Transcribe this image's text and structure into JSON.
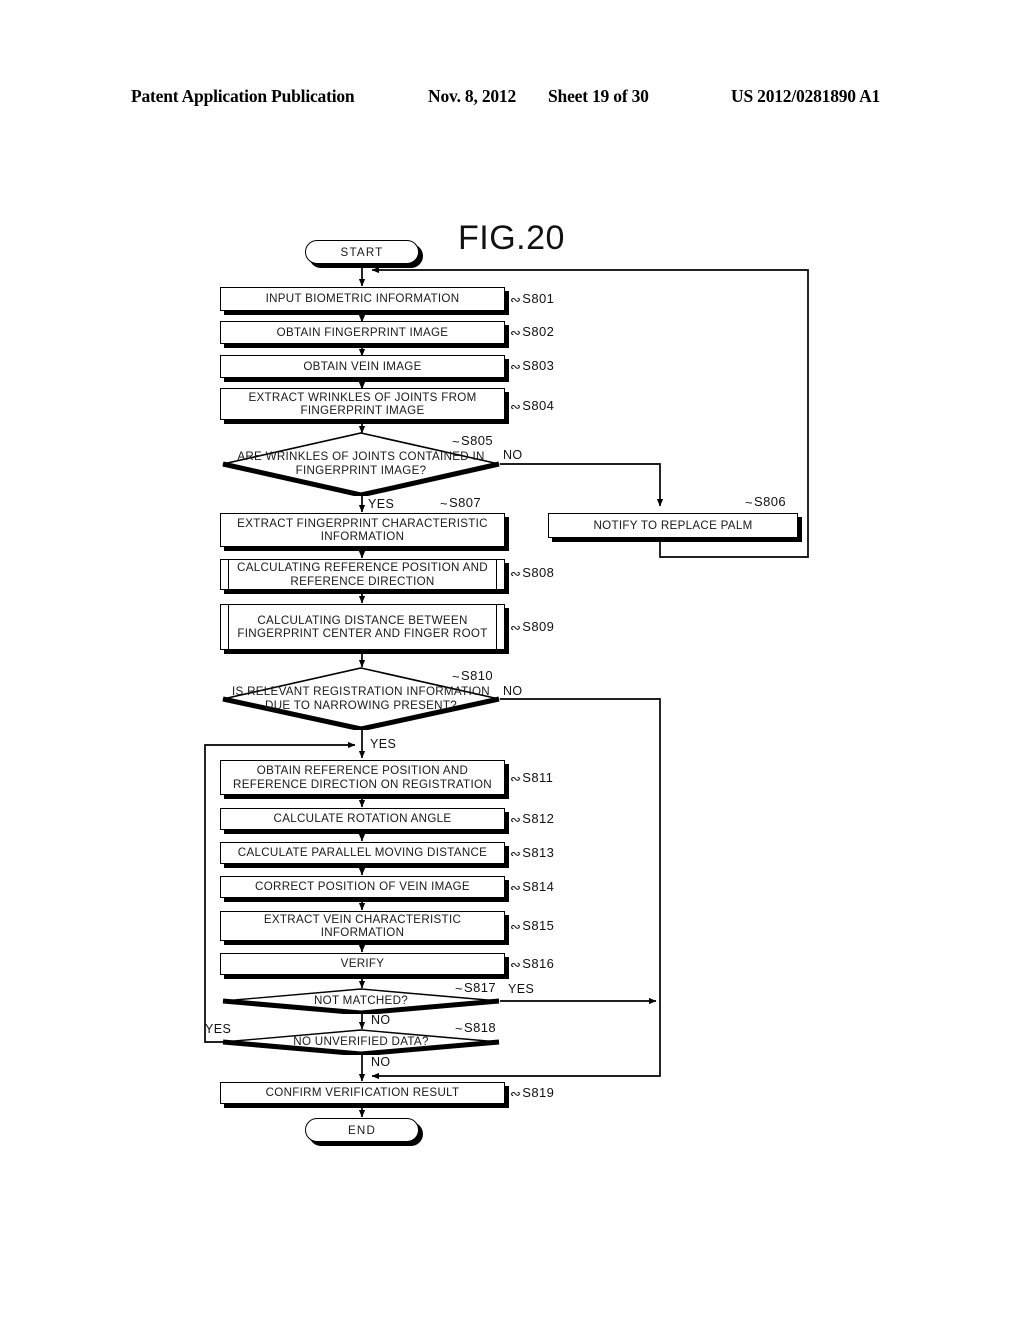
{
  "header": {
    "publication": "Patent Application Publication",
    "date": "Nov. 8, 2012",
    "sheet": "Sheet 19 of 30",
    "patent_number": "US 2012/0281890 A1"
  },
  "figure": {
    "title": "FIG.20"
  },
  "flowchart": {
    "terminators": {
      "start": "START",
      "end": "END"
    },
    "nodes": [
      {
        "id": "S801",
        "type": "process",
        "label": "INPUT BIOMETRIC INFORMATION",
        "ref": "S801"
      },
      {
        "id": "S802",
        "type": "process",
        "label": "OBTAIN FINGERPRINT IMAGE",
        "ref": "S802"
      },
      {
        "id": "S803",
        "type": "process",
        "label": "OBTAIN VEIN IMAGE",
        "ref": "S803"
      },
      {
        "id": "S804",
        "type": "process",
        "label": "EXTRACT WRINKLES OF JOINTS FROM FINGERPRINT IMAGE",
        "ref": "S804"
      },
      {
        "id": "S805",
        "type": "decision",
        "label": "ARE WRINKLES OF JOINTS CONTAINED IN FINGERPRINT IMAGE?",
        "ref": "S805"
      },
      {
        "id": "S806",
        "type": "process",
        "label": "NOTIFY TO REPLACE PALM",
        "ref": "S806"
      },
      {
        "id": "S807",
        "type": "process",
        "label": "EXTRACT FINGERPRINT CHARACTERISTIC INFORMATION",
        "ref": "S807"
      },
      {
        "id": "S808",
        "type": "predefined",
        "label": "CALCULATING REFERENCE POSITION AND REFERENCE DIRECTION",
        "ref": "S808"
      },
      {
        "id": "S809",
        "type": "predefined",
        "label": "CALCULATING DISTANCE BETWEEN FINGERPRINT CENTER AND FINGER ROOT",
        "ref": "S809"
      },
      {
        "id": "S810",
        "type": "decision",
        "label": "IS RELEVANT REGISTRATION INFORMATION DUE TO NARROWING PRESENT?",
        "ref": "S810"
      },
      {
        "id": "S811",
        "type": "process",
        "label": "OBTAIN REFERENCE POSITION AND REFERENCE DIRECTION ON REGISTRATION",
        "ref": "S811"
      },
      {
        "id": "S812",
        "type": "process",
        "label": "CALCULATE ROTATION ANGLE",
        "ref": "S812"
      },
      {
        "id": "S813",
        "type": "process",
        "label": "CALCULATE PARALLEL MOVING DISTANCE",
        "ref": "S813"
      },
      {
        "id": "S814",
        "type": "process",
        "label": "CORRECT POSITION OF VEIN IMAGE",
        "ref": "S814"
      },
      {
        "id": "S815",
        "type": "process",
        "label": "EXTRACT VEIN CHARACTERISTIC INFORMATION",
        "ref": "S815"
      },
      {
        "id": "S816",
        "type": "process",
        "label": "VERIFY",
        "ref": "S816"
      },
      {
        "id": "S817",
        "type": "decision-flat",
        "label": "NOT MATCHED?",
        "ref": "S817"
      },
      {
        "id": "S818",
        "type": "decision-flat",
        "label": "NO UNVERIFIED DATA?",
        "ref": "S818"
      },
      {
        "id": "S819",
        "type": "process",
        "label": "CONFIRM VERIFICATION RESULT",
        "ref": "S819"
      }
    ],
    "branch_labels": {
      "s805_no": "NO",
      "s805_yes": "YES",
      "s810_no": "NO",
      "s810_yes": "YES",
      "s817_yes": "YES",
      "s817_no": "NO",
      "s818_yes": "YES",
      "s818_no": "NO"
    }
  },
  "colors": {
    "ink": "#000000",
    "paper": "#ffffff"
  }
}
